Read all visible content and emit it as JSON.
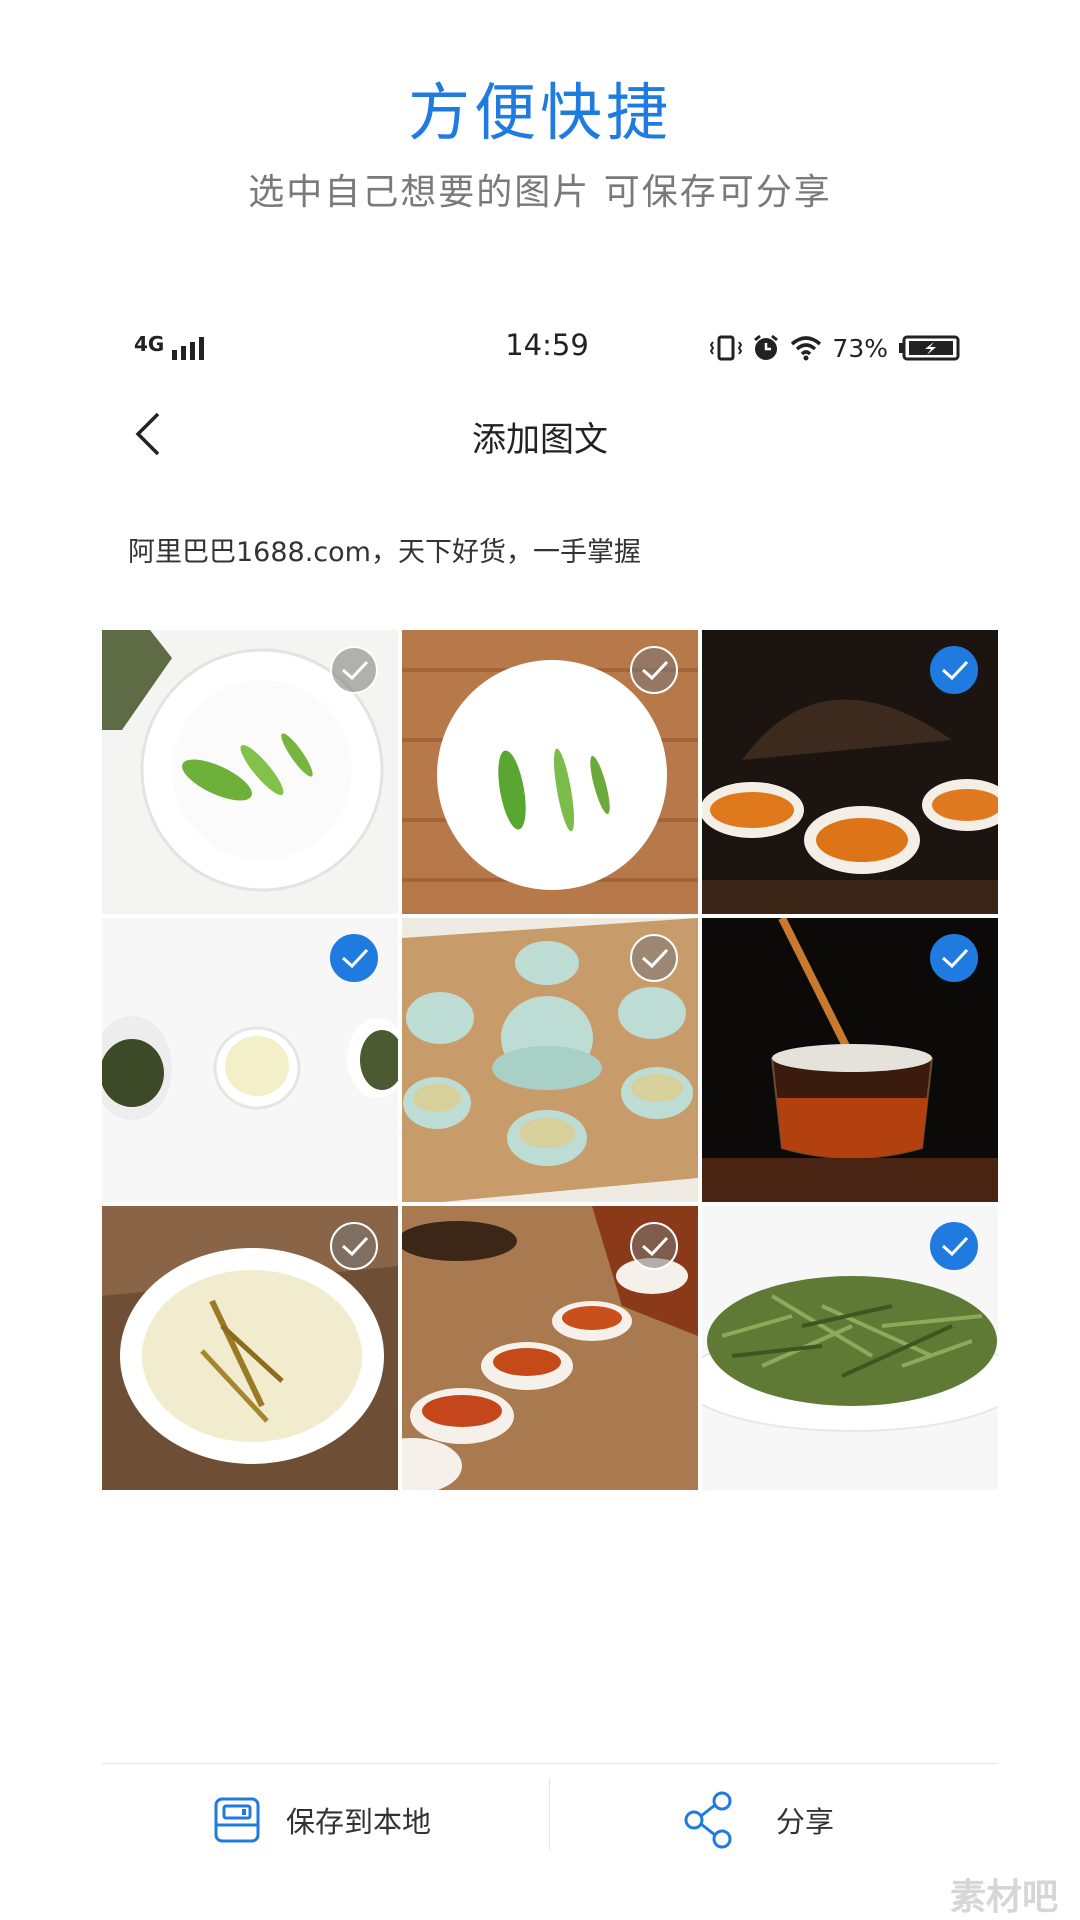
{
  "promo": {
    "title": "方便快捷",
    "subtitle": "选中自己想要的图片 可保存可分享"
  },
  "status_bar": {
    "network": "4G",
    "time": "14:59",
    "battery_pct": "73%",
    "icons": [
      "signal-icon",
      "vibrate-icon",
      "alarm-icon",
      "wifi-icon",
      "battery-icon"
    ]
  },
  "nav": {
    "title": "添加图文",
    "back_icon": "chevron-left-icon"
  },
  "description": "阿里巴巴1688.com，天下好货，一手掌握",
  "images": [
    {
      "subject": "tea-leaves-white-plate",
      "selected": false
    },
    {
      "subject": "tea-leaves-wooden-table",
      "selected": false
    },
    {
      "subject": "black-tea-cups",
      "selected": true
    },
    {
      "subject": "tea-leaves-and-cup",
      "selected": true
    },
    {
      "subject": "celadon-tea-set",
      "selected": false
    },
    {
      "subject": "pouring-tea-glass",
      "selected": true
    },
    {
      "subject": "tea-in-white-dish",
      "selected": false
    },
    {
      "subject": "tea-cups-row",
      "selected": false
    },
    {
      "subject": "green-tea-pile",
      "selected": true
    }
  ],
  "actions": {
    "save_label": "保存到本地",
    "share_label": "分享"
  },
  "watermark": "素材吧",
  "colors": {
    "accent": "#1f7be0",
    "subtitle": "#7a7a7a",
    "text": "#333333"
  }
}
